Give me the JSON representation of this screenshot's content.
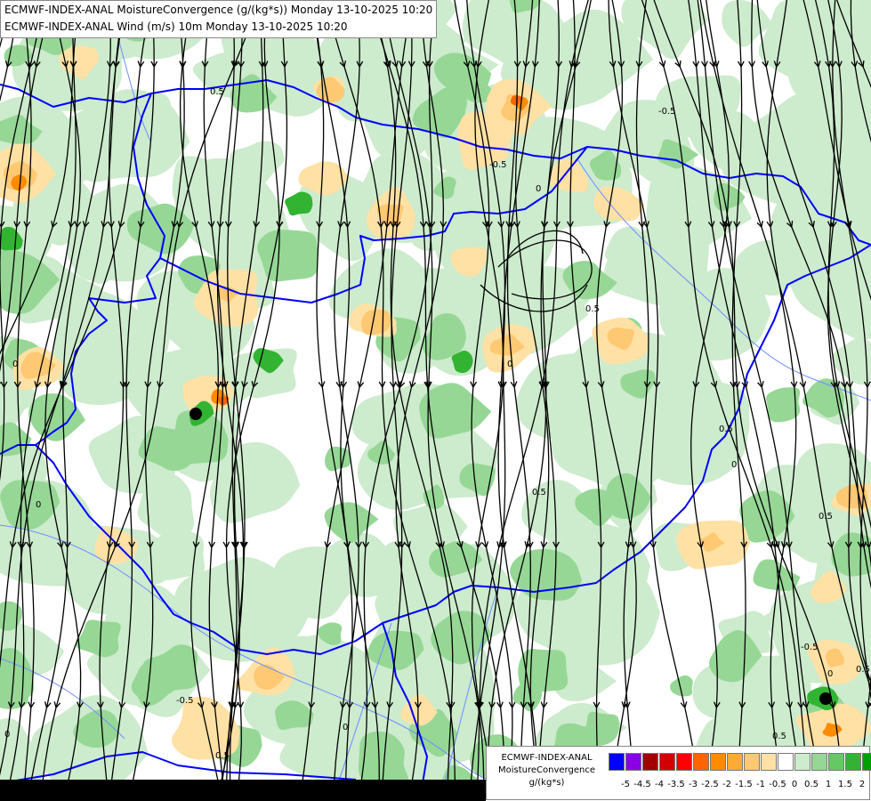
{
  "titles": {
    "line1": "ECMWF-INDEX-ANAL MoistureConvergence (g/(kg*s)) Monday 13-10-2025 10:20",
    "line2": "ECMWF-INDEX-ANAL Wind (m/s) 10m Monday 13-10-2025 10:20"
  },
  "legend": {
    "name_line1": "ECMWF-INDEX-ANAL",
    "name_line2": "MoistureConvergence",
    "units": "g/(kg*s)",
    "colors": [
      "#0000ff",
      "#8a00e6",
      "#a00000",
      "#d20000",
      "#ff0000",
      "#ff6400",
      "#ff8c00",
      "#ffaa32",
      "#ffc873",
      "#ffe1a5",
      "#ffffff",
      "#cdebcd",
      "#96d796",
      "#64c864",
      "#32b432",
      "#00a000"
    ],
    "ticks": [
      "-5",
      "-4.5",
      "-4",
      "-3.5",
      "-3",
      "-2.5",
      "-2",
      "-1.5",
      "-1",
      "-0.5",
      "0",
      "0.5",
      "1",
      "1.5",
      "2"
    ]
  },
  "map": {
    "contour_labels": [
      "0",
      "0.5",
      "-0.5",
      "0",
      "0.5",
      "0",
      "-0.5",
      "0.5",
      "0",
      "0.5",
      "0",
      "-0.5",
      "0.5",
      "0",
      "0.5",
      "0",
      "0.5",
      "-0.5",
      "0",
      "0.5"
    ],
    "colors": {
      "background": "#ffffff",
      "green_light": "#cdebcd",
      "green_mid": "#96d796",
      "green_dark": "#32b432",
      "orange_light": "#ffe1a5",
      "orange_mid": "#ffc873",
      "orange_dark": "#ff8c00",
      "red": "#ff6400",
      "border": "#0000ff",
      "river": "#6e8cff",
      "streamline": "#000000"
    }
  }
}
